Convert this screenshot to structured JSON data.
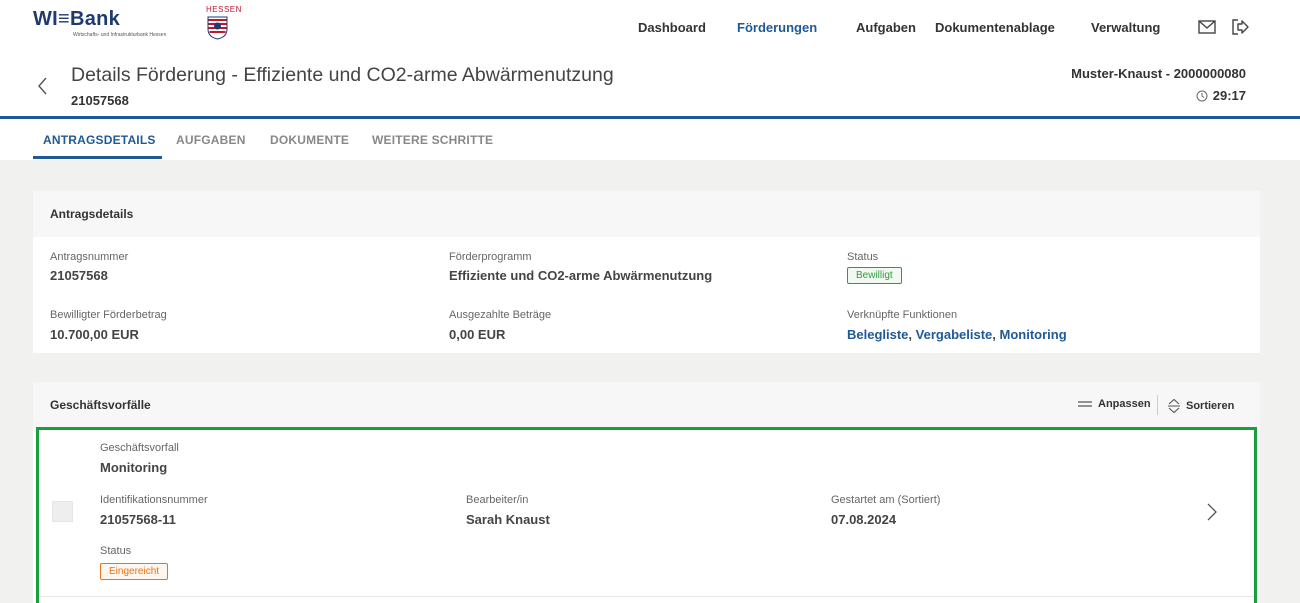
{
  "logo": {
    "brand": "WI≡Bank",
    "subtitle": "Wirtschafts- und Infrastrukturbank Hessen",
    "state": "HESSEN"
  },
  "nav": {
    "items": [
      "Dashboard",
      "Förderungen",
      "Aufgaben",
      "Dokumentenablage",
      "Verwaltung"
    ],
    "active": "Förderungen",
    "icons": [
      "mail-icon",
      "logout-icon"
    ]
  },
  "header": {
    "title": "Details Förderung - Effiziente und CO2-arme Abwärmenutzung",
    "id": "21057568",
    "user": "Muster-Knaust - 2000000080",
    "timer": "29:17"
  },
  "tabs": {
    "items": [
      "ANTRAGSDETAILS",
      "AUFGABEN",
      "DOKUMENTE",
      "WEITERE SCHRITTE"
    ],
    "active": "ANTRAGSDETAILS"
  },
  "details": {
    "title": "Antragsdetails",
    "antragsnummer_label": "Antragsnummer",
    "antragsnummer": "21057568",
    "programm_label": "Förderprogramm",
    "programm": "Effiziente und CO2-arme Abwärmenutzung",
    "status_label": "Status",
    "status": "Bewilligt",
    "betrag_label": "Bewilligter Förderbetrag",
    "betrag": "10.700,00 EUR",
    "ausgezahlt_label": "Ausgezahlte Beträge",
    "ausgezahlt": "0,00 EUR",
    "funktionen_label": "Verknüpfte Funktionen",
    "funktionen": [
      "Belegliste",
      "Vergabeliste",
      "Monitoring"
    ],
    "funktionen_sep": ", "
  },
  "geschaeft": {
    "title": "Geschäftsvorfälle",
    "anpassen": "Anpassen",
    "sortieren": "Sortieren",
    "row": {
      "vorfall_label": "Geschäftsvorfall",
      "vorfall": "Monitoring",
      "id_label": "Identifikationsnummer",
      "id": "21057568-11",
      "bearbeiter_label": "Bearbeiter/in",
      "bearbeiter": "Sarah Knaust",
      "gestartet_label": "Gestartet am (Sortiert)",
      "gestartet": "07.08.2024",
      "status_label": "Status",
      "status": "Eingereicht"
    }
  },
  "colors": {
    "brand": "#1f5a96",
    "success": "#2e9d3a",
    "warning": "#e8731a",
    "highlight": "#1aa03a"
  }
}
